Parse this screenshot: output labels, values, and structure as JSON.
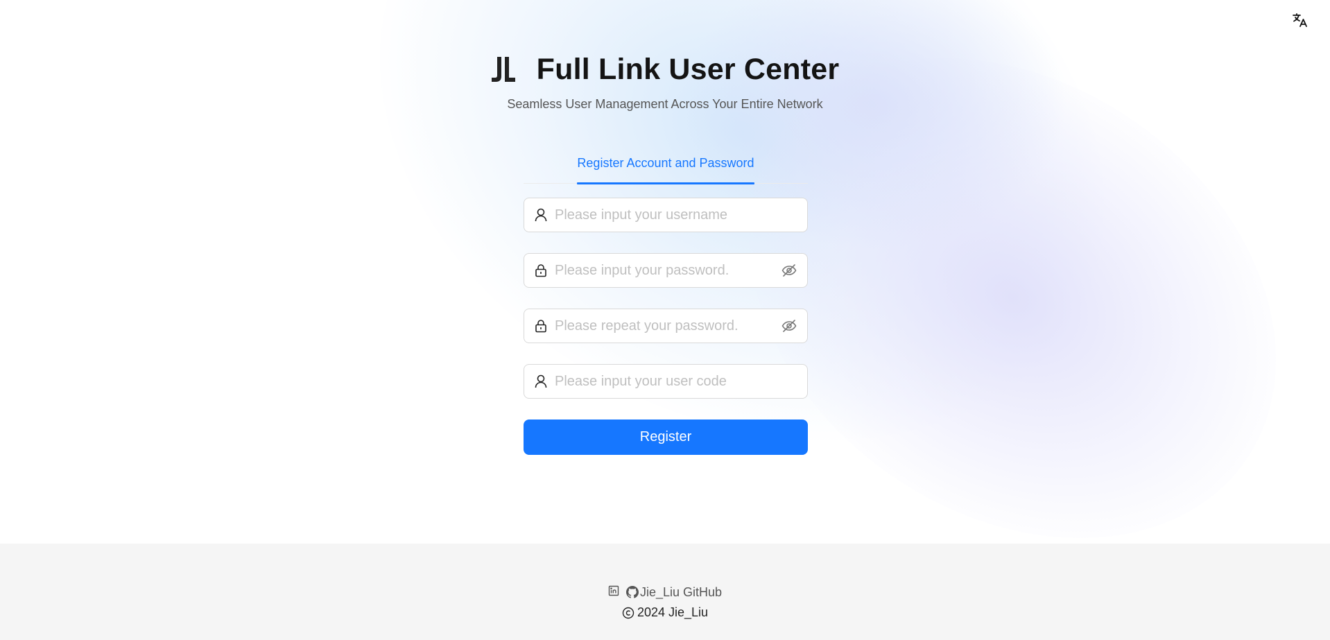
{
  "header": {
    "title": "Full Link User Center",
    "subtitle": "Seamless User Management Across Your Entire Network",
    "logo_icon": "jl-logo-icon"
  },
  "language_button": {
    "icon": "translate-icon"
  },
  "tabs": [
    {
      "label": "Register Account and Password",
      "active": true
    }
  ],
  "form": {
    "username": {
      "value": "",
      "placeholder": "Please input your username",
      "icon": "user-icon"
    },
    "password": {
      "value": "",
      "placeholder": "Please input your password.",
      "icon": "lock-icon",
      "suffix_icon": "eye-invisible-icon"
    },
    "confirm_password": {
      "value": "",
      "placeholder": "Please repeat your password.",
      "icon": "lock-icon",
      "suffix_icon": "eye-invisible-icon"
    },
    "user_code": {
      "value": "",
      "placeholder": "Please input your user code",
      "icon": "user-icon"
    },
    "submit_label": "Register"
  },
  "footer": {
    "link_label": "Jie_Liu GitHub",
    "link_icons": [
      "linkedin-icon",
      "github-icon"
    ],
    "copyright": "2024 Jie_Liu"
  },
  "colors": {
    "primary": "#1677ff",
    "footer_bg": "#f5f5f5",
    "title": "#141414"
  }
}
